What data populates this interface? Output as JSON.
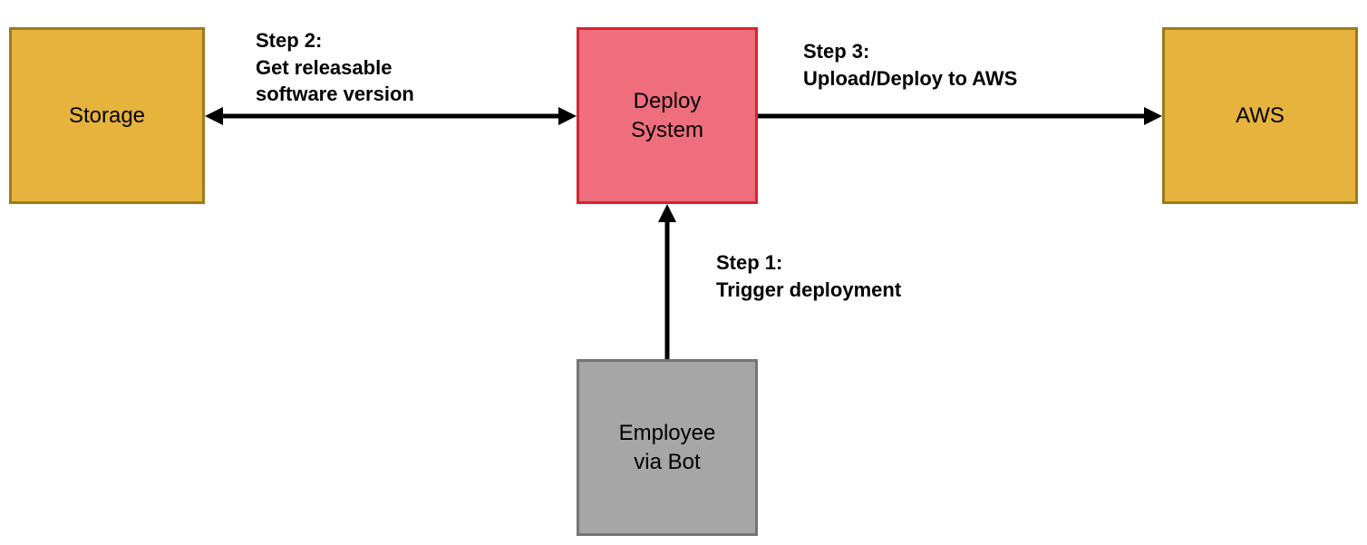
{
  "nodes": {
    "storage": {
      "label": "Storage"
    },
    "deploy": {
      "label": "Deploy\nSystem"
    },
    "aws": {
      "label": "AWS"
    },
    "employee": {
      "label": "Employee\nvia Bot"
    }
  },
  "edges": {
    "step1": {
      "title": "Step 1:",
      "desc": "Trigger deployment"
    },
    "step2": {
      "title": "Step 2:",
      "desc": "Get releasable\nsoftware version"
    },
    "step3": {
      "title": "Step 3:",
      "desc": "Upload/Deploy to AWS"
    }
  },
  "colors": {
    "storage_fill": "#e6b33d",
    "storage_border": "#9d7a21",
    "deploy_fill": "#ee6e7d",
    "deploy_border": "#d7232f",
    "aws_fill": "#e6b33d",
    "aws_border": "#9d7a21",
    "employee_fill": "#a6a6a6",
    "employee_border": "#757575"
  }
}
